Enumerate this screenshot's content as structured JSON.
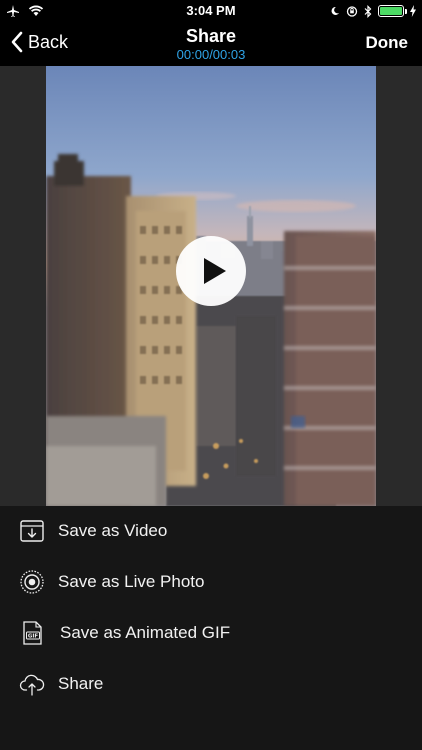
{
  "status_bar": {
    "time": "3:04 PM",
    "left_icons": [
      "airplane-icon",
      "wifi-icon"
    ],
    "right_icons": [
      "moon-icon",
      "orientation-lock-icon",
      "bluetooth-icon",
      "battery-icon",
      "charging-icon"
    ],
    "battery_level": 1.0,
    "battery_color": "#4cd964"
  },
  "nav": {
    "back_label": "Back",
    "title": "Share",
    "timecode": "00:00/00:03",
    "done_label": "Done",
    "accent_color": "#2fa3e6"
  },
  "video": {
    "play_icon": "play-icon"
  },
  "actions": [
    {
      "label": "Save as Video",
      "icon": "save-video-icon"
    },
    {
      "label": "Save as Live Photo",
      "icon": "live-photo-icon"
    },
    {
      "label": "Save as Animated GIF",
      "icon": "gif-file-icon"
    },
    {
      "label": "Share",
      "icon": "cloud-upload-icon"
    }
  ]
}
